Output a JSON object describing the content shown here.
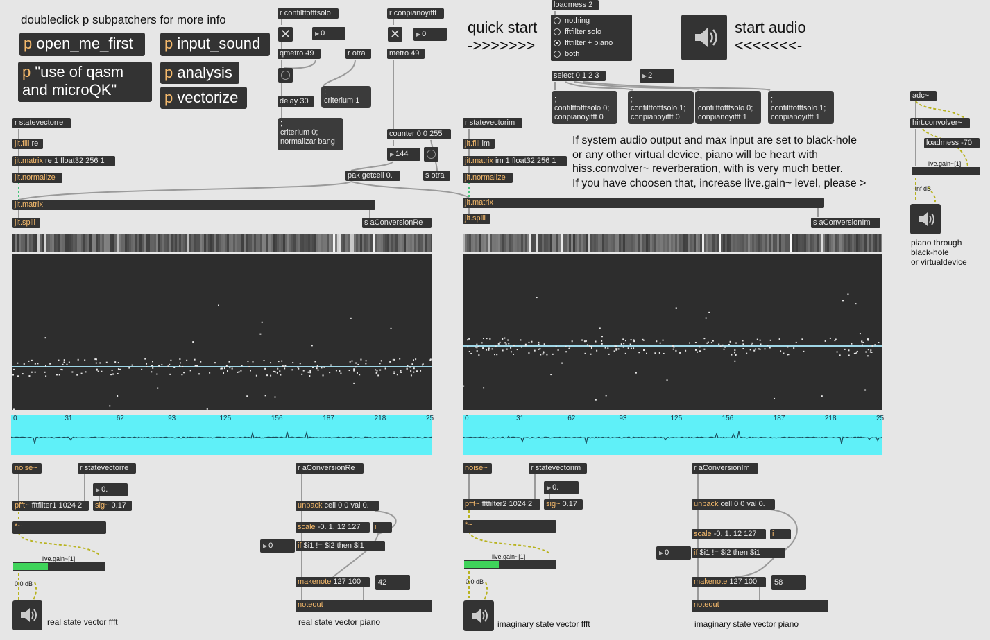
{
  "info": {
    "doubleclick": "doubleclick p subpatchers for more info",
    "quick_start": "quick start\n->>>>>>>",
    "start_audio": "start audio\n<<<<<<<-",
    "note": "If system audio output and max input are set to black-hole\nor any other virtual device, piano will be heart with\nhiss.convolver~ reverberation, with is very much better.\nIf you have choosen that, increase live.gain~ level, please >",
    "piano_through": "piano through\nblack-hole\nor virtualdevice"
  },
  "subpatchers": {
    "open_me_first": "open_me_first",
    "input_sound": "input_sound",
    "qasm": "\"use of qasm\nand microQK\"",
    "analysis": "analysis",
    "vectorize": "vectorize",
    "prefix": "p"
  },
  "ctrl": {
    "r_solo": "r confilttofftsolo",
    "r_piano": "r conpianoyifft",
    "num0a": "0",
    "num0b": "0",
    "qmetro": "qmetro 49",
    "r_otra": "r otra",
    "metro": "metro 49",
    "delay": "delay 30",
    "crit1": ";\ncriterium 1",
    "crit0": ";\ncriterium 0;\nnormalizar bang",
    "counter": "counter 0 0 255",
    "num144": "144",
    "s_otra": "s otra",
    "pak": "pak getcell 0."
  },
  "loadmess": {
    "loadmess2": "loadmess 2",
    "radio": [
      "nothing",
      "fftfilter solo",
      "fftfilter + piano",
      "both"
    ],
    "radio_selected": 2,
    "select": "select 0 1 2 3",
    "num2": "2",
    "m1": ";\nconfilttofftsolo 0;\nconpianoyifft 0",
    "m2": ";\nconfilttofftsolo 1;\nconpianoyifft 0",
    "m3": ";\nconfilttofftsolo 0;\nconpianoyifft 1",
    "m4": ";\nconfilttofftsolo 1;\nconpianoyifft 1"
  },
  "right": {
    "adc": "adc~",
    "hirt": "hirt.convolver~",
    "loadmess70": "loadmess -70",
    "gain_label": "live.gain~[1]",
    "gain_db": "-inf dB"
  },
  "left": {
    "r_state": "r statevectorre",
    "fill": "jit.fill re",
    "matrix": "jit.matrix re 1 float32 256 1",
    "normalize": "jit.normalize",
    "jmatrix": "jit.matrix",
    "spill": "jit.spill",
    "s_conv": "s aConversionRe",
    "ticks": [
      "0",
      "31",
      "62",
      "93",
      "125",
      "156",
      "187",
      "218",
      "25"
    ],
    "noise": "noise~",
    "r_state2": "r statevectorre",
    "num0": "0.",
    "pfft": "pfft~ fftfilter1 1024 2",
    "sig": "sig~ 0.17",
    "mul": "*~",
    "gain_label": "live.gain~[1]",
    "gain_db": "0.0 dB",
    "gain_level": 0.38,
    "caption": "real state vector ffft",
    "r_conv": "r aConversionRe",
    "unpack": "unpack cell 0 0 val 0.",
    "scale": "scale -0. 1. 12 127",
    "i": "i",
    "num_zero": "0",
    "if": "if $i1 != $i2 then $i1",
    "makenote": "makenote 127 100",
    "num42": "42",
    "noteout": "noteout",
    "caption2": "real state vector piano"
  },
  "rightside": {
    "r_state": "r statevectorim",
    "fill": "jit.fill im",
    "matrix": "jit.matrix im 1 float32 256 1",
    "normalize": "jit.normalize",
    "jmatrix": "jit.matrix",
    "spill": "jit.spill",
    "s_conv": "s aConversionIm",
    "ticks": [
      "0",
      "31",
      "62",
      "93",
      "125",
      "156",
      "187",
      "218",
      "25"
    ],
    "noise": "noise~",
    "r_state2": "r statevectorim",
    "num0": "0.",
    "pfft": "pfft~ fftfilter2 1024 2",
    "sig": "sig~ 0.17",
    "mul": "*~",
    "gain_label": "live.gain~[1]",
    "gain_db": "0.0 dB",
    "gain_level": 0.38,
    "caption": "imaginary state vector ffft",
    "r_conv": "r aConversionIm",
    "unpack": "unpack cell 0 0 val 0.",
    "scale": "scale -0. 1. 12 127",
    "i": "i",
    "num_zero": "0",
    "if": "if $i1 != $i2 then $i1",
    "makenote": "makenote 127 100",
    "num58": "58",
    "noteout": "noteout",
    "caption2": "imaginary state vector piano"
  },
  "colors": {
    "background": "#e6e6e6",
    "object": "#333333",
    "operator": "#f4b96b",
    "cyan": "#5ff0f8",
    "meter": "#3fd35a"
  }
}
